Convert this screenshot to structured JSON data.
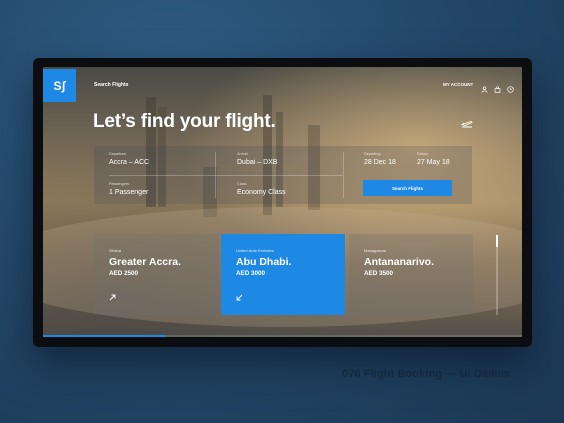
{
  "app": {
    "logo": "Sʃ"
  },
  "nav": {
    "search_flights": "Search Flights",
    "my_account": "MY ACCOUNT"
  },
  "icons": {
    "user": "user-icon",
    "bag": "bag-icon",
    "clock": "clock-icon",
    "plane": "plane-departure-icon",
    "arrow_up_right": "arrow-up-right-icon",
    "arrow_down_left": "arrow-down-left-icon"
  },
  "hero": {
    "title": "Let’s find your flight."
  },
  "form": {
    "departure_label": "Departure",
    "departure_value": "Accra – ACC",
    "arrival_label": "Arrival",
    "arrival_value": "Dubai – DXB",
    "departing_label": "Departing",
    "departing_value": "28 Dec 18",
    "return_label": "Return",
    "return_value": "27 May 18",
    "passengers_label": "Passengers",
    "passengers_value": "1 Passenger",
    "class_label": "Class",
    "class_value": "Economy Class",
    "search_button": "Search Flights"
  },
  "destinations": [
    {
      "country": "Ghana",
      "city": "Greater Accra.",
      "price": "AED 2500",
      "active": false
    },
    {
      "country": "United Arab Emirates",
      "city": "Abu Dhabi.",
      "price": "AED 3000",
      "active": true
    },
    {
      "country": "Madagascar",
      "city": "Antananarivo.",
      "price": "AED 3500",
      "active": false
    }
  ],
  "colors": {
    "accent": "#1e88e5",
    "background": "#24496b",
    "caption": "#15283d"
  },
  "caption": "076 Flight Booking — Ui Dailies"
}
